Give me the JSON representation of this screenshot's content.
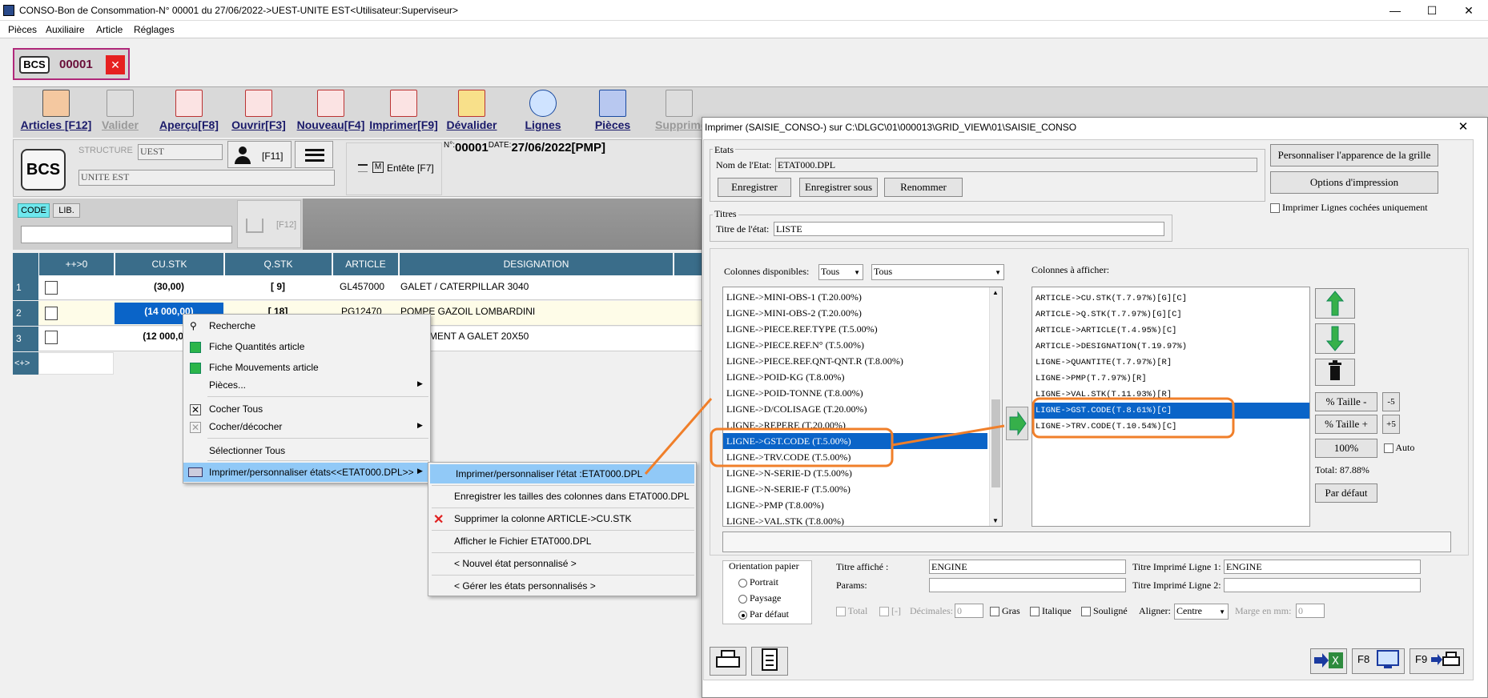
{
  "window": {
    "title": "CONSO-Bon de Consommation-N° 00001 du 27/06/2022->UEST-UNITE EST<Utilisateur:Superviseur>",
    "minimize": "—",
    "maximize": "☐",
    "close": "✕"
  },
  "menubar": [
    "Pièces",
    "Auxiliaire",
    "Article",
    "Réglages"
  ],
  "doc_tab": {
    "logo": "BCS",
    "number": "00001",
    "close": "✕"
  },
  "toolbar": [
    {
      "label": "Articles [F12]",
      "icon": "articles-icon",
      "enabled": true
    },
    {
      "label": "Valider",
      "icon": "valider-icon",
      "enabled": false
    },
    {
      "label": "Aperçu[F8]",
      "icon": "apercu-icon",
      "enabled": true
    },
    {
      "label": "Ouvrir[F3]",
      "icon": "ouvrir-icon",
      "enabled": true
    },
    {
      "label": "Nouveau[F4]",
      "icon": "nouveau-icon",
      "enabled": true
    },
    {
      "label": "Imprimer[F9]",
      "icon": "imprimer-icon",
      "enabled": true
    },
    {
      "label": "Dévalider",
      "icon": "devalider-icon",
      "enabled": true
    },
    {
      "label": "Lignes",
      "icon": "lignes-icon",
      "enabled": true
    },
    {
      "label": "Pièces",
      "icon": "pieces-icon",
      "enabled": true
    },
    {
      "label": "Supprime",
      "icon": "supprimer-icon",
      "enabled": false
    }
  ],
  "header": {
    "logo": "BCS",
    "structure_label": "STRUCTURE",
    "structure_value": "UEST",
    "unite": "UNITE EST",
    "f11": "[F11]",
    "entete": "Entête [F7]",
    "entete_icon": "M",
    "n_label": "N°:",
    "number": "00001",
    "date_label": "DATE:",
    "date": "27/06/2022",
    "pmp": "[PMP]"
  },
  "search": {
    "code_tab": "CODE",
    "lib_tab": "LIB.",
    "f12": "[F12]"
  },
  "grid": {
    "columns": [
      "++>0",
      "CU.STK",
      "Q.STK",
      "ARTICLE",
      "DESIGNATION"
    ],
    "rows": [
      {
        "n": "1",
        "cu": "(30,00)",
        "q": "[ 9]",
        "article": "GL457000",
        "designation": "GALET / CATERPILLAR 3040"
      },
      {
        "n": "2",
        "cu": "(14 000,00)",
        "q": "[ 18]",
        "article": "PG12470",
        "designation": "POMPE GAZOIL LOMBARDINI"
      },
      {
        "n": "3",
        "cu": "(12 000,0",
        "q": "",
        "article": "",
        "designation": "EMENT A GALET 20X50"
      }
    ],
    "footer": "<+>"
  },
  "context_menu": [
    {
      "label": "Recherche",
      "icon": "binoculars-icon"
    },
    {
      "label": "Fiche Quantités article",
      "icon": "green-m-icon"
    },
    {
      "label": "Fiche Mouvements article",
      "icon": "green-m-icon"
    },
    {
      "label": "Pièces...",
      "submenu": true
    },
    {
      "label": "Cocher Tous",
      "icon": "checkbox-x-icon"
    },
    {
      "label": "Cocher/décocher",
      "icon": "checkbox-x-icon",
      "submenu": true
    },
    {
      "label": "Sélectionner Tous"
    },
    {
      "label": "Imprimer/personnaliser états<<ETAT000.DPL>>",
      "icon": "printer-icon",
      "submenu": true,
      "highlighted": true
    }
  ],
  "submenu": [
    {
      "label": "Imprimer/personnaliser l'état :ETAT000.DPL",
      "highlighted": true
    },
    {
      "label": "Enregistrer les tailles des colonnes dans ETAT000.DPL"
    },
    {
      "label": "Supprimer la colonne ARTICLE->CU.STK",
      "icon": "red-x-icon"
    },
    {
      "label": "Afficher le Fichier ETAT000.DPL"
    },
    {
      "label": "< Nouvel état personnalisé >"
    },
    {
      "label": "< Gérer les états personnalisés >"
    }
  ],
  "dialog": {
    "title": "Imprimer (SAISIE_CONSO-)  sur C:\\DLGC\\01\\000013\\GRID_VIEW\\01\\SAISIE_CONSO",
    "close": "✕",
    "etats_group": "Etats",
    "nom_label": "Nom de l'Etat:",
    "nom_value": "ETAT000.DPL",
    "btn_enregistrer": "Enregistrer",
    "btn_enregistrer_sous": "Enregistrer sous",
    "btn_renommer": "Renommer",
    "btn_apparence": "Personnaliser l'apparence de la grille",
    "btn_options": "Options d'impression",
    "chk_cochees": "Imprimer Lignes cochées uniquement",
    "titres_group": "Titres",
    "titre_label": "Titre de l'état:",
    "titre_value": "LISTE",
    "dispo_label": "Colonnes disponibles:",
    "filter1": "Tous",
    "filter2": "Tous",
    "afficher_label": "Colonnes à afficher:",
    "available": [
      "LIGNE->MINI-OBS-1  (T.20.00%)",
      "LIGNE->MINI-OBS-2  (T.20.00%)",
      "LIGNE->PIECE.REF.TYPE  (T.5.00%)",
      "LIGNE->PIECE.REF.N°  (T.5.00%)",
      "LIGNE->PIECE.REF.QNT-QNT.R  (T.8.00%)",
      "LIGNE->POID-KG  (T.8.00%)",
      "LIGNE->POID-TONNE  (T.8.00%)",
      "LIGNE->D/COLISAGE  (T.20.00%)",
      "LIGNE->REPERE  (T.20.00%)",
      "LIGNE->GST.CODE  (T.5.00%)",
      "LIGNE->TRV.CODE  (T.5.00%)",
      "LIGNE->N-SERIE-D  (T.5.00%)",
      "LIGNE->N-SERIE-F  (T.5.00%)",
      "LIGNE->PMP  (T.8.00%)",
      "LIGNE->VAL.STK  (T.8.00%)"
    ],
    "selected": [
      "ARTICLE->CU.STK(T.7.97%)[G][C]",
      "ARTICLE->Q.STK(T.7.97%)[G][C]",
      "ARTICLE->ARTICLE(T.4.95%)[C]",
      "ARTICLE->DESIGNATION(T.19.97%)",
      "LIGNE->QUANTITE(T.7.97%)[R]",
      "LIGNE->PMP(T.7.97%)[R]",
      "LIGNE->VAL.STK(T.11.93%)[R]",
      "LIGNE->GST.CODE(T.8.61%)[C]",
      "LIGNE->TRV.CODE(T.10.54%)[C]"
    ],
    "btn_taille_minus": "% Taille -",
    "btn_minus5": "-5",
    "btn_taille_plus": "% Taille +",
    "btn_plus5": "+5",
    "btn_100": "100%",
    "chk_auto": "Auto",
    "total": "Total:  87.88%",
    "btn_defaut": "Par défaut",
    "orientation_group": "Orientation papier",
    "orient_portrait": "Portrait",
    "orient_paysage": "Paysage",
    "orient_defaut": "Par défaut",
    "titre_affiche_label": "Titre affiché :",
    "titre_affiche": "ENGINE",
    "params_label": "Params:",
    "params": "",
    "titre_l1_label": "Titre Imprimé Ligne 1:",
    "titre_l1": "ENGINE",
    "titre_l2_label": "Titre Imprimé Ligne 2:",
    "titre_l2": "",
    "chk_total": "Total",
    "chk_bracket": "[-]",
    "decimales_label": "Décimales:",
    "decimales": "0",
    "chk_gras": "Gras",
    "chk_italique": "Italique",
    "chk_souligne": "Souligné",
    "aligner_label": "Aligner:",
    "aligner": "Centre",
    "marge_label": "Marge en mm:",
    "marge": "0",
    "f8": "F8",
    "f9": "F9"
  },
  "colors": {
    "accent": "#0a64c8",
    "highlight_orange": "#f07f2a",
    "grid_header": "#3a6d8a"
  }
}
